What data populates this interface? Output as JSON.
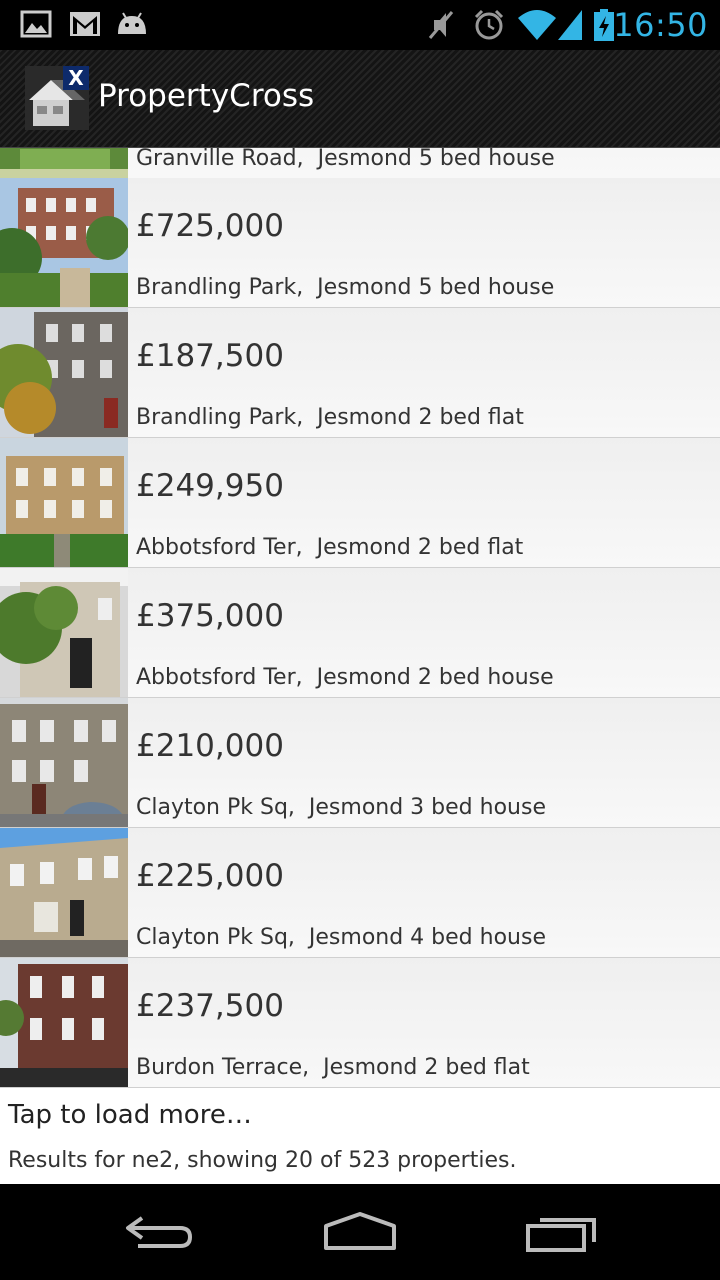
{
  "status_bar": {
    "time": "16:50",
    "left_icons": [
      "picture-icon",
      "gmail-icon",
      "android-icon"
    ],
    "right_icons": [
      "mute-icon",
      "alarm-icon",
      "wifi-icon",
      "signal-icon",
      "battery-charging-icon"
    ],
    "time_color": "#33b5e5"
  },
  "action_bar": {
    "title": "PropertyCross",
    "icon": "propertycross-logo-icon"
  },
  "list": {
    "partial_item": {
      "title": "Granville Road,  Jesmond 5 bed house"
    },
    "items": [
      {
        "price": "£725,000",
        "title": "Brandling Park,  Jesmond 5 bed house"
      },
      {
        "price": "£187,500",
        "title": "Brandling Park,  Jesmond 2 bed flat"
      },
      {
        "price": "£249,950",
        "title": "Abbotsford Ter,  Jesmond 2 bed flat"
      },
      {
        "price": "£375,000",
        "title": "Abbotsford Ter,  Jesmond 2 bed house"
      },
      {
        "price": "£210,000",
        "title": "Clayton Pk Sq,  Jesmond 3 bed house"
      },
      {
        "price": "£225,000",
        "title": "Clayton Pk Sq,  Jesmond 4 bed house"
      },
      {
        "price": "£237,500",
        "title": "Burdon Terrace,  Jesmond 2 bed flat"
      }
    ],
    "load_more": {
      "label": "Tap to load more…",
      "status": "Results for ne2, showing 20 of 523 properties."
    }
  },
  "nav_bar": {
    "buttons": [
      "back-icon",
      "home-icon",
      "recent-apps-icon"
    ]
  }
}
